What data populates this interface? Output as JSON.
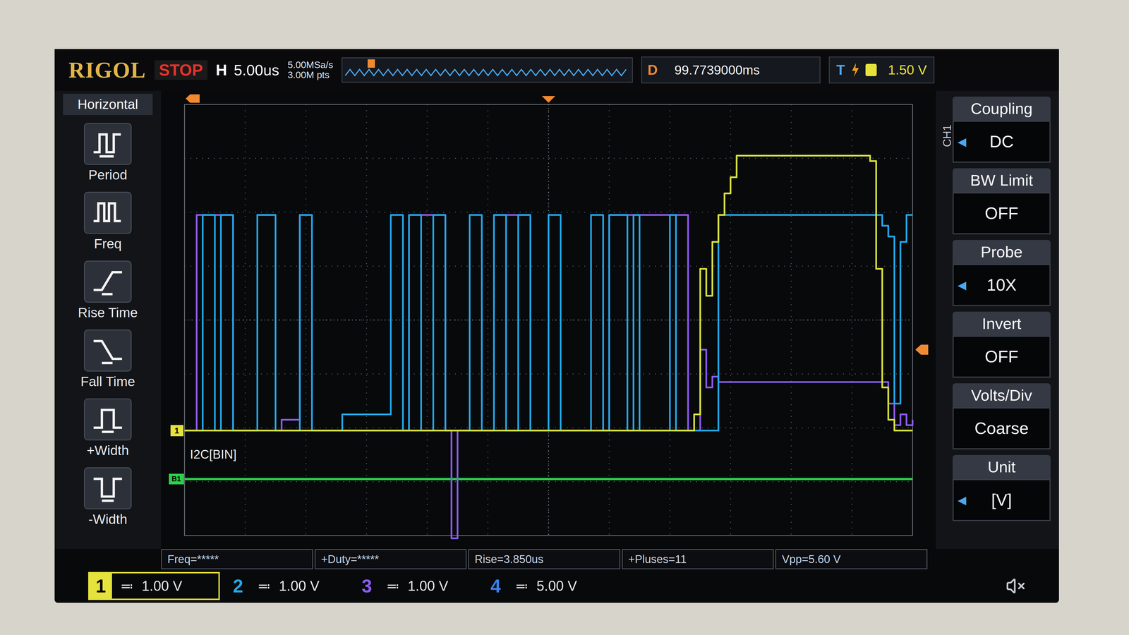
{
  "brand": "RIGOL",
  "run_state": "STOP",
  "timebase": {
    "label": "H",
    "value": "5.00us"
  },
  "acquisition": {
    "sample_rate": "5.00MSa/s",
    "memory_depth": "3.00M pts"
  },
  "delay": {
    "label": "D",
    "value": "99.7739000ms"
  },
  "trigger": {
    "label": "T",
    "level": "1.50 V"
  },
  "left_menu": {
    "title": "Horizontal",
    "items": [
      {
        "label": "Period"
      },
      {
        "label": "Freq"
      },
      {
        "label": "Rise Time"
      },
      {
        "label": "Fall Time"
      },
      {
        "label": "+Width"
      },
      {
        "label": "-Width"
      }
    ]
  },
  "right_menu": {
    "channel": "CH1",
    "items": [
      {
        "label": "Coupling",
        "value": "DC",
        "indicator": "◀"
      },
      {
        "label": "BW Limit",
        "value": "OFF",
        "indicator": ""
      },
      {
        "label": "Probe",
        "value": "10X",
        "indicator": "◀"
      },
      {
        "label": "Invert",
        "value": "OFF",
        "indicator": ""
      },
      {
        "label": "Volts/Div",
        "value": "Coarse",
        "indicator": ""
      },
      {
        "label": "Unit",
        "value": "[V]",
        "indicator": "◀"
      }
    ]
  },
  "decoder": {
    "label": "I2C[BIN]",
    "marker": "B1"
  },
  "measurements": [
    "Freq=*****",
    "+Duty=*****",
    "Rise=3.850us",
    "+Pluses=11",
    "Vpp=5.60 V"
  ],
  "channels": [
    {
      "name": "1",
      "coupling_symbol": "≕",
      "scale": "1.00 V",
      "selected": true,
      "color": "#e6e23c"
    },
    {
      "name": "2",
      "coupling_symbol": "≕",
      "scale": "1.00 V",
      "selected": false,
      "color": "#22a8e8"
    },
    {
      "name": "3",
      "coupling_symbol": "≕",
      "scale": "1.00 V",
      "selected": false,
      "color": "#8a5cf0"
    },
    {
      "name": "4",
      "coupling_symbol": "≕",
      "scale": "5.00 V",
      "selected": false,
      "color": "#3b7fe8"
    }
  ],
  "chart": {
    "x_range_us": 60,
    "x_step_us": 0.5,
    "y_top_v": 6.05,
    "y_bottom_v": -1.95,
    "trigger_level_v": 1.5,
    "bus_level_v": 5.1,
    "series": [
      {
        "channel": "1",
        "color": "#d6e040",
        "values": [
          0,
          0,
          0,
          0,
          0,
          0,
          0,
          0,
          0,
          0,
          0,
          0,
          0,
          0,
          0,
          0,
          0,
          0,
          0,
          0,
          0,
          0,
          0,
          0,
          0,
          0,
          0,
          0,
          0,
          0,
          0,
          0,
          0,
          0,
          0,
          0,
          0,
          0,
          0,
          0,
          0,
          0,
          0,
          0,
          0,
          0,
          0,
          0,
          0,
          0,
          0,
          0,
          0,
          0,
          0,
          0,
          0,
          0,
          0,
          0,
          0,
          0,
          0,
          0,
          0,
          0,
          0,
          0,
          0,
          0,
          0,
          0,
          0,
          0,
          0,
          0,
          0,
          0,
          0,
          0,
          0,
          0,
          0,
          0,
          0.3,
          3.0,
          2.5,
          3.5,
          4.0,
          4.4,
          4.7,
          5.1,
          5.1,
          5.1,
          5.1,
          5.1,
          5.1,
          5.1,
          5.1,
          5.1,
          5.1,
          5.1,
          5.1,
          5.1,
          5.1,
          5.1,
          5.1,
          5.1,
          5.1,
          5.1,
          5.1,
          5.1,
          5.1,
          5.0,
          3.0,
          0.8,
          0.2,
          0,
          0,
          0
        ]
      },
      {
        "channel": "2",
        "color": "#22a8e8",
        "values": [
          0,
          0,
          0,
          4,
          4,
          0,
          4,
          4,
          0,
          0,
          0,
          0,
          4,
          4,
          4,
          0,
          0,
          0,
          0,
          4,
          4,
          0,
          0,
          0,
          0,
          0,
          0.3,
          0.3,
          0.3,
          0.3,
          0.3,
          0.3,
          0.3,
          0.3,
          4,
          4,
          0,
          4,
          4,
          0,
          0,
          4,
          4,
          0,
          0,
          0,
          0,
          4,
          4,
          0,
          0,
          4,
          4,
          0,
          0,
          4,
          4,
          0,
          0,
          0,
          4,
          4,
          0,
          0,
          0,
          0,
          0,
          4,
          4,
          0,
          4,
          4,
          4,
          0,
          4,
          0,
          0,
          0,
          0,
          0,
          4,
          0,
          0,
          0,
          0,
          0,
          0,
          0,
          4,
          4,
          4,
          4,
          4,
          4,
          4,
          4,
          4,
          4,
          4,
          4,
          4,
          4,
          4,
          4,
          4,
          4,
          4,
          4,
          4,
          4,
          4,
          4,
          4,
          4,
          4,
          3.8,
          3.6,
          0.5,
          3.5,
          4,
          4
        ]
      },
      {
        "channel": "3",
        "color": "#8a5cf0",
        "values": [
          0,
          0,
          4,
          4,
          4,
          4,
          4,
          4,
          0,
          0,
          0,
          0,
          4,
          4,
          4,
          0,
          0.2,
          0.2,
          0.2,
          4,
          4,
          0,
          0,
          0,
          0,
          0,
          0,
          0,
          0,
          0,
          0,
          0,
          0,
          0,
          0,
          0,
          0,
          4,
          4,
          4,
          4,
          4,
          4,
          0,
          -2,
          0,
          0,
          0,
          0,
          0,
          0,
          4,
          4,
          4,
          4,
          4,
          4,
          0,
          0,
          0,
          0,
          0,
          0,
          0,
          0,
          0,
          0,
          0,
          0,
          0,
          4,
          4,
          4,
          4,
          4,
          4,
          4,
          4,
          4,
          4,
          4,
          4,
          4,
          0,
          0,
          1.5,
          0.8,
          1.0,
          0.9,
          0.9,
          0.9,
          0.9,
          0.9,
          0.9,
          0.9,
          0.9,
          0.9,
          0.9,
          0.9,
          0.9,
          0.9,
          0.9,
          0.9,
          0.9,
          0.9,
          0.9,
          0.9,
          0.9,
          0.9,
          0.9,
          0.9,
          0.9,
          0.9,
          0.9,
          0.9,
          0.9,
          0.5,
          0.1,
          0.3,
          0.1,
          0.2
        ]
      }
    ]
  }
}
